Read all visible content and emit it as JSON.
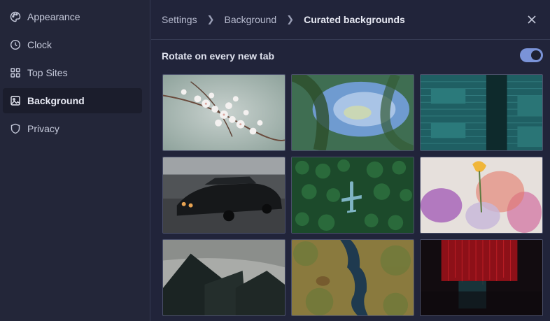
{
  "sidebar": {
    "items": [
      {
        "label": "Appearance",
        "icon": "palette-icon"
      },
      {
        "label": "Clock",
        "icon": "clock-icon"
      },
      {
        "label": "Top Sites",
        "icon": "grid-icon"
      },
      {
        "label": "Background",
        "icon": "image-icon",
        "active": true
      },
      {
        "label": "Privacy",
        "icon": "shield-icon"
      }
    ]
  },
  "header": {
    "breadcrumb": [
      "Settings",
      "Background",
      "Curated backgrounds"
    ],
    "close_icon": "close-icon"
  },
  "rotate": {
    "label": "Rotate on every new tab",
    "enabled": true
  },
  "backgrounds": [
    {
      "name": "cherry-blossom"
    },
    {
      "name": "swirl-sky"
    },
    {
      "name": "teal-building"
    },
    {
      "name": "vintage-car"
    },
    {
      "name": "forest-airplane"
    },
    {
      "name": "flower-painting"
    },
    {
      "name": "dark-skyscrapers"
    },
    {
      "name": "aerial-lakes"
    },
    {
      "name": "red-abstract"
    }
  ],
  "colors": {
    "accent": "#7a93d8",
    "background": "#21243a",
    "sidebar_active": "#1b1d2c"
  }
}
